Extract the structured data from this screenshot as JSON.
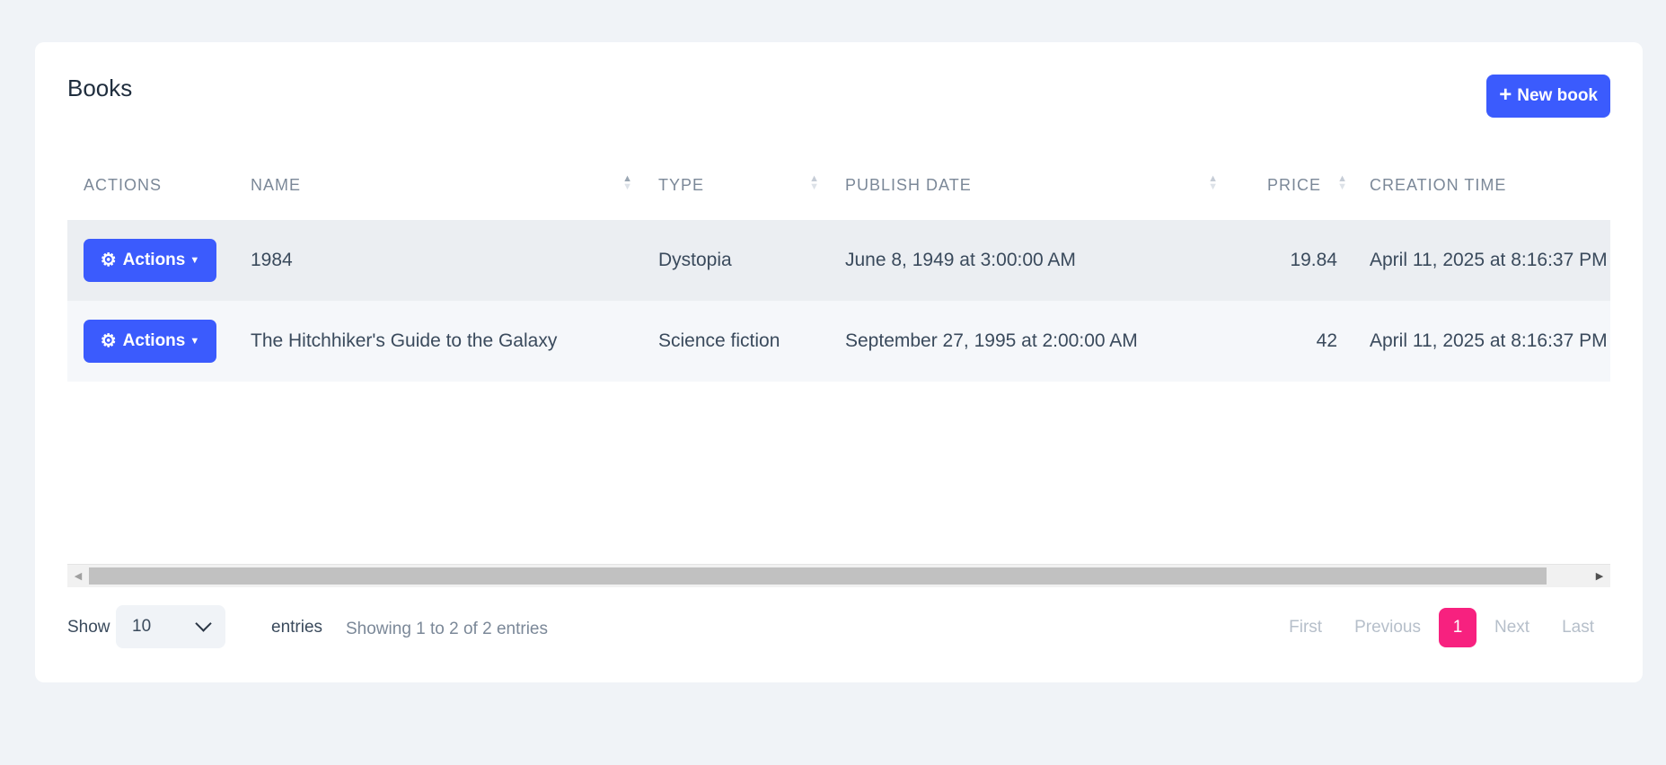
{
  "card": {
    "title": "Books",
    "new_button_label": "New book"
  },
  "table": {
    "headers": [
      "ACTIONS",
      "NAME",
      "TYPE",
      "PUBLISH DATE",
      "PRICE",
      "CREATION TIME"
    ],
    "rows": [
      {
        "action": "Actions",
        "name": "1984",
        "type": "Dystopia",
        "publish_date": "June 8, 1949 at 3:00:00 AM",
        "price": "19.84",
        "creation_time": "April 11, 2025 at 8:16:37 PM"
      },
      {
        "action": "Actions",
        "name": "The Hitchhiker's Guide to the Galaxy",
        "type": "Science fiction",
        "publish_date": "September 27, 1995 at 2:00:00 AM",
        "price": "42",
        "creation_time": "April 11, 2025 at 8:16:37 PM"
      }
    ]
  },
  "footer": {
    "show_label": "Show",
    "page_size": "10",
    "entries_label": "entries",
    "info": "Showing 1 to 2 of 2 entries",
    "pager": {
      "first": "First",
      "previous": "Previous",
      "current": "1",
      "next": "Next",
      "last": "Last"
    }
  },
  "colors": {
    "primary": "#3b5bfd",
    "active_page": "#f7217f",
    "background": "#f0f3f7"
  }
}
